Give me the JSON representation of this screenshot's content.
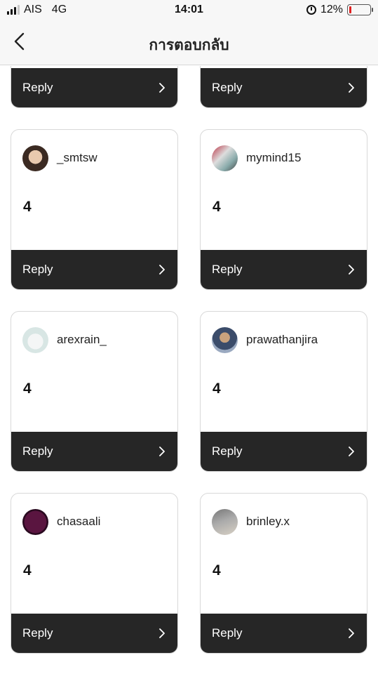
{
  "status": {
    "carrier": "AIS",
    "network": "4G",
    "time": "14:01",
    "battery": "12%",
    "battery_level": 0.12
  },
  "header": {
    "title": "การตอบกลับ"
  },
  "reply_label": "Reply",
  "cards": [
    {
      "username": "_smtsw",
      "count": "4",
      "reply": "Reply"
    },
    {
      "username": "mymind15",
      "count": "4",
      "reply": "Reply"
    },
    {
      "username": "arexrain_",
      "count": "4",
      "reply": "Reply"
    },
    {
      "username": "prawathanjira",
      "count": "4",
      "reply": "Reply"
    },
    {
      "username": "chasaali",
      "count": "4",
      "reply": "Reply"
    },
    {
      "username": "brinley.x",
      "count": "4",
      "reply": "Reply"
    }
  ]
}
